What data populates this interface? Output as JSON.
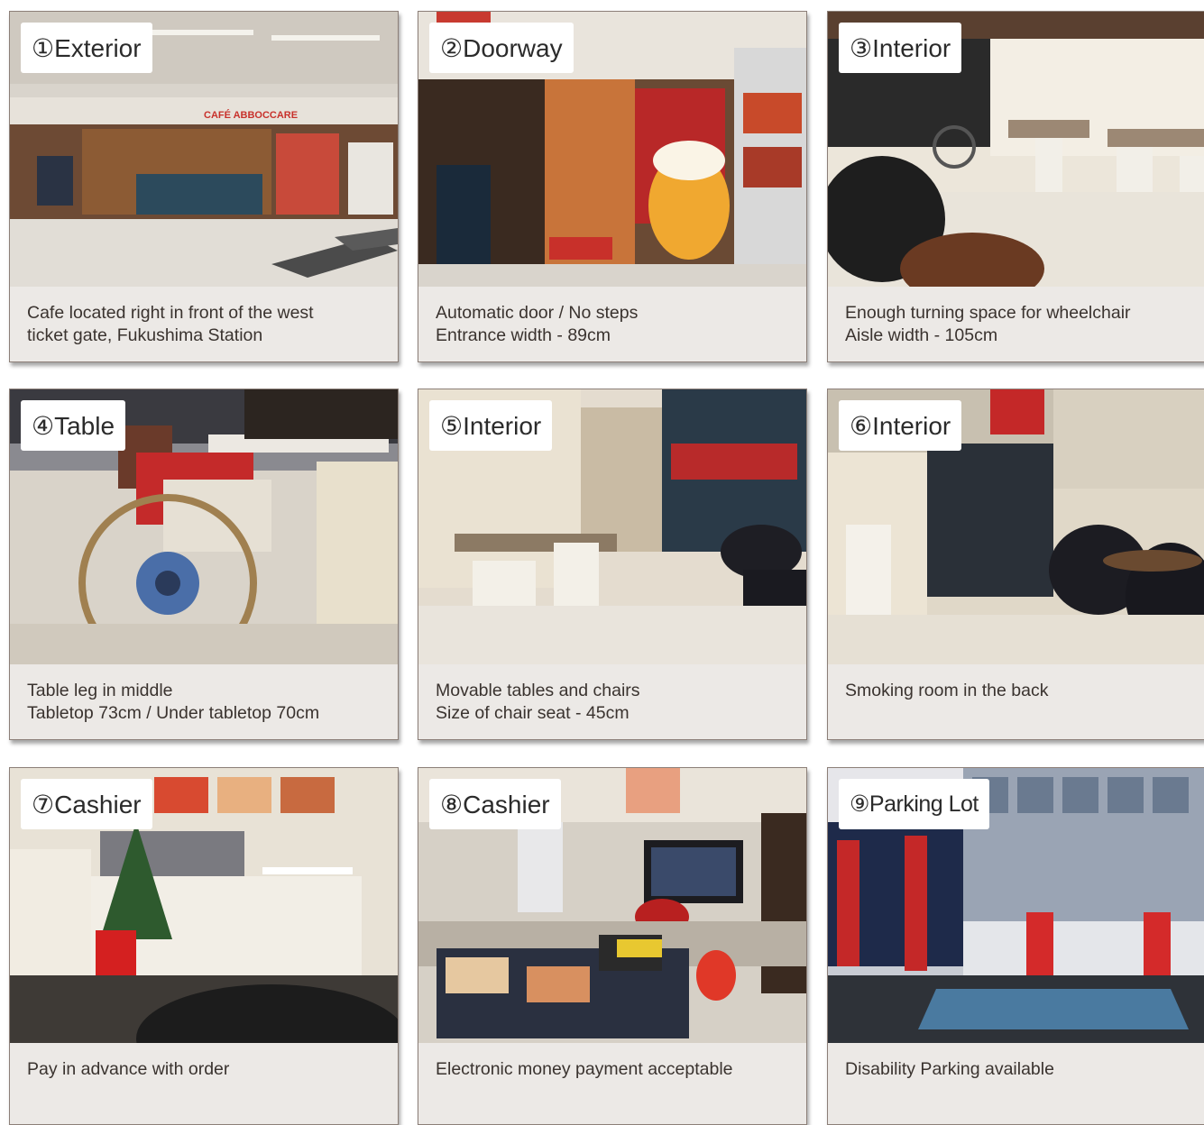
{
  "cards": [
    {
      "label": "①Exterior",
      "line1": "Cafe located right in front of the west",
      "line2": "ticket gate, Fukushima Station"
    },
    {
      "label": "②Doorway",
      "line1": "Automatic door / No steps",
      "line2": "Entrance width - 89cm"
    },
    {
      "label": "③Interior",
      "line1": "Enough turning space for wheelchair",
      "line2": "Aisle width - 105cm"
    },
    {
      "label": "④Table",
      "line1": "Table leg in middle",
      "line2": "Tabletop 73cm / Under tabletop 70cm"
    },
    {
      "label": "⑤Interior",
      "line1": "Movable tables and chairs",
      "line2": "Size of chair seat - 45cm"
    },
    {
      "label": "⑥Interior",
      "line1": "Smoking room in the back",
      "line2": ""
    },
    {
      "label": "⑦Cashier",
      "line1": "Pay in advance with order",
      "line2": ""
    },
    {
      "label": "⑧Cashier",
      "line1": "Electronic money payment acceptable",
      "line2": ""
    },
    {
      "label": "⑨Parking Lot",
      "line1": "Disability Parking available",
      "line2": ""
    }
  ],
  "storefront_sign": "CAFÉ ABBOCCARE",
  "colors": {
    "card_bg": "#ece9e6",
    "card_border": "#8c7f78",
    "caption_text": "#3a332f",
    "label_bg": "#ffffff"
  }
}
